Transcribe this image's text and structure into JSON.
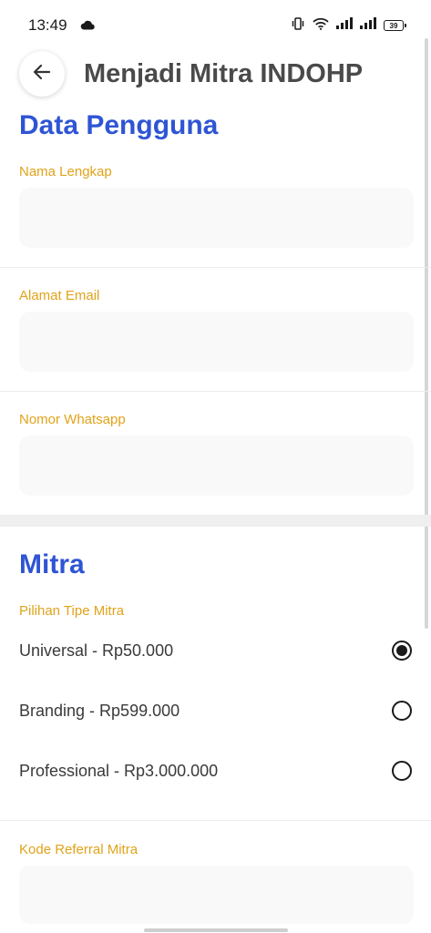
{
  "status_bar": {
    "time": "13:49",
    "battery": "39",
    "icons": [
      "cloud-icon",
      "vibrate-icon",
      "wifi-icon",
      "signal-icon",
      "signal-icon",
      "battery-icon"
    ]
  },
  "header": {
    "back_icon": "arrow-left-icon",
    "title": "Menjadi Mitra INDOHP"
  },
  "data_pengguna": {
    "title": "Data Pengguna",
    "fields": [
      {
        "label": "Nama Lengkap",
        "value": "",
        "placeholder": ""
      },
      {
        "label": "Alamat Email",
        "value": "",
        "placeholder": ""
      },
      {
        "label": "Nomor Whatsapp",
        "value": "",
        "placeholder": ""
      }
    ]
  },
  "mitra": {
    "title": "Mitra",
    "type_label": "Pilihan Tipe Mitra",
    "options": [
      {
        "label": "Universal - Rp50.000",
        "selected": true
      },
      {
        "label": "Branding - Rp599.000",
        "selected": false
      },
      {
        "label": "Professional - Rp3.000.000",
        "selected": false
      }
    ],
    "referral": {
      "label": "Kode Referral Mitra",
      "value": "",
      "placeholder": ""
    }
  },
  "colors": {
    "section_title": "#2f55d4",
    "field_label": "#e0a31a",
    "input_bg": "#f9f9f9",
    "title_text": "#4a4a4a"
  }
}
